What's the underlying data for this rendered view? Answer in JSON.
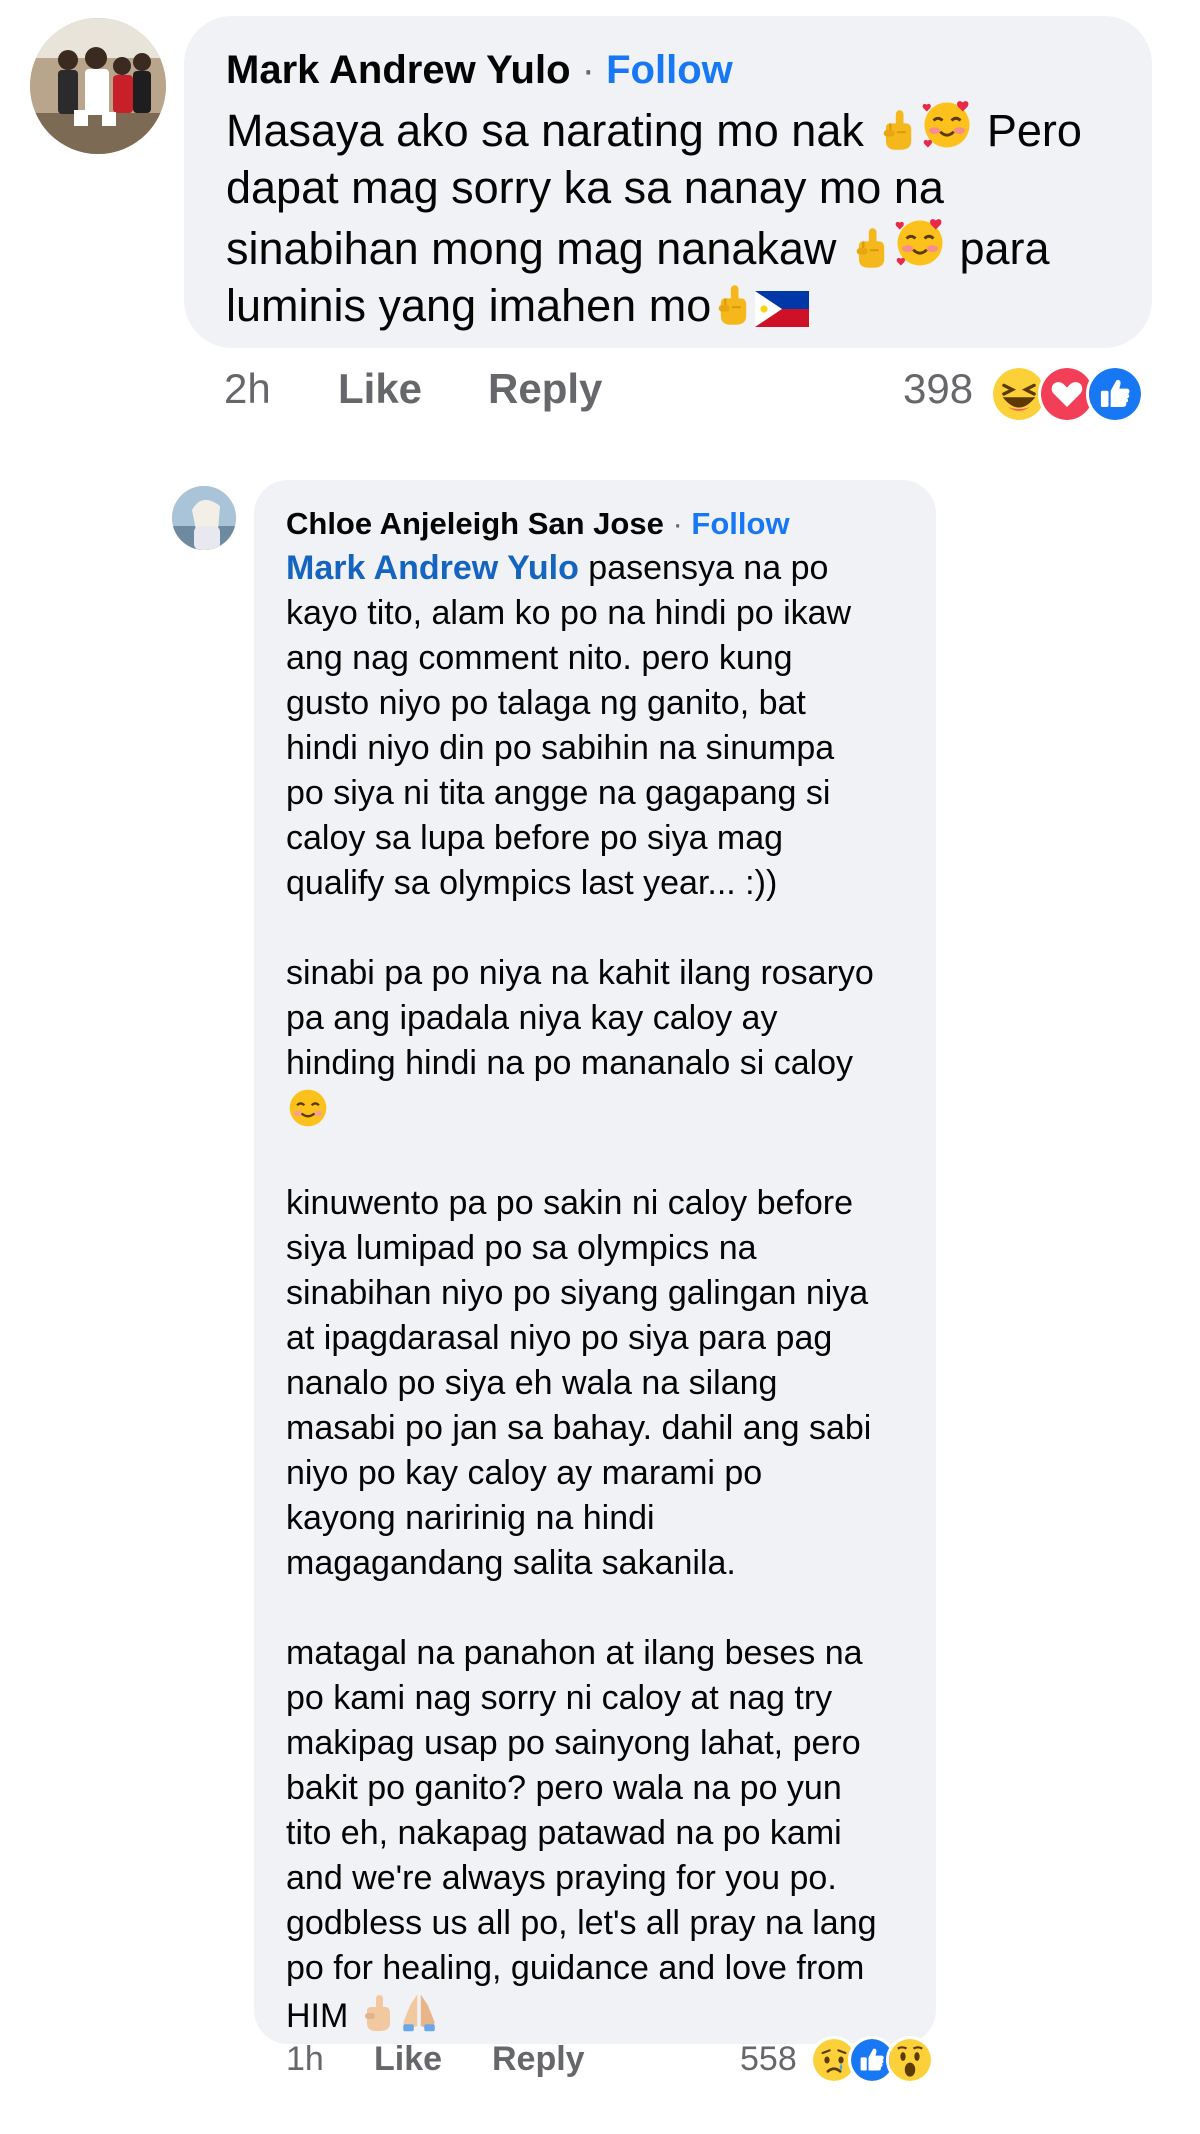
{
  "comment1": {
    "author": "Mark Andrew Yulo",
    "dot": "·",
    "follow": "Follow",
    "lines": [
      "Masaya ako sa narating mo nak",
      "Pero",
      "dapat mag sorry ka sa nanay mo na",
      "sinabihan mong mag nanakaw",
      "para",
      "luminis yang imahen mo"
    ],
    "time": "2h",
    "like": "Like",
    "reply": "Reply",
    "reaction_count": "398",
    "reaction_icons": [
      "laugh-emoji-icon",
      "love-heart-icon",
      "like-thumb-icon"
    ]
  },
  "reply1": {
    "author": "Chloe Anjeleigh San Jose",
    "dot": "·",
    "follow": "Follow",
    "mention": "Mark Andrew Yulo",
    "first_line_rest": " pasensya na po",
    "para1": [
      "kayo tito, alam ko po na hindi po ikaw",
      "ang nag comment nito. pero kung",
      "gusto niyo po talaga ng ganito, bat",
      "hindi niyo din po sabihin na sinumpa",
      "po siya ni tita angge na gagapang si",
      "caloy sa lupa before po siya mag",
      "qualify sa olympics last year... :))"
    ],
    "para2": [
      "sinabi pa po niya na kahit ilang rosaryo",
      "pa ang ipadala niya kay caloy ay",
      "hinding hindi na po mananalo si caloy"
    ],
    "para3": [
      "kinuwento pa po sakin ni caloy before",
      "siya lumipad po sa olympics na",
      "sinabihan niyo po siyang galingan niya",
      "at ipagdarasal niyo po siya para pag",
      "nanalo po siya eh wala na silang",
      "masabi po jan sa bahay. dahil ang sabi",
      "niyo po kay caloy ay marami po",
      "kayong naririnig na hindi",
      "magagandang salita sakanila."
    ],
    "para4": [
      "matagal na panahon at ilang beses na",
      "po kami nag sorry ni caloy at nag try",
      "makipag usap po sainyong lahat, pero",
      "bakit po ganito? pero wala na po yun",
      "tito eh, nakapag patawad na po kami",
      "and we're always praying for you po.",
      "godbless us all po, let's all pray na lang",
      "po for healing, guidance and love from",
      "HIM"
    ],
    "time": "1h",
    "like": "Like",
    "reply": "Reply",
    "reaction_count": "558",
    "reaction_icons": [
      "sad-emoji-icon",
      "like-thumb-icon",
      "wow-emoji-icon"
    ]
  },
  "colors": {
    "bubble": "#f0f2f5",
    "link": "#1877f2",
    "mention": "#1565c0",
    "meta": "#65676b",
    "text": "#050505"
  }
}
